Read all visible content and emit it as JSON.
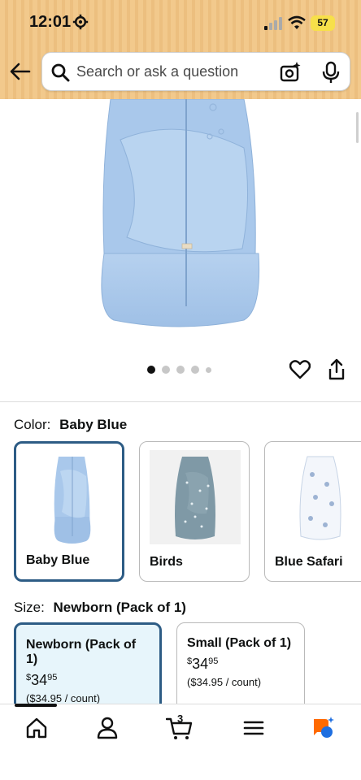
{
  "status_bar": {
    "time": "12:01",
    "battery": "57",
    "icons": [
      "gear-icon",
      "signal-icon",
      "wifi-icon",
      "battery-icon"
    ]
  },
  "search": {
    "placeholder": "Search or ask a question",
    "icons": [
      "back-arrow-icon",
      "search-icon",
      "camera-icon",
      "microphone-icon"
    ]
  },
  "image_carousel": {
    "total_slides": 5,
    "active_index": 0,
    "actions": [
      "heart-icon",
      "share-icon"
    ]
  },
  "color": {
    "label": "Color:",
    "selected": "Baby Blue",
    "options": [
      {
        "name": "Baby Blue"
      },
      {
        "name": "Birds"
      },
      {
        "name": "Blue Safari"
      }
    ]
  },
  "size": {
    "label": "Size:",
    "selected": "Newborn (Pack of 1)",
    "options": [
      {
        "title": "Newborn (Pack of 1)",
        "price_whole": "34",
        "price_fraction": "95",
        "price_currency": "$",
        "unit_price": "($34.95 / count)"
      },
      {
        "title": "Small (Pack of 1)",
        "price_whole": "34",
        "price_fraction": "95",
        "price_currency": "$",
        "unit_price": "($34.95 / count)"
      }
    ]
  },
  "bottom_nav": {
    "cart_count": "3",
    "items": [
      "home-icon",
      "account-icon",
      "cart-icon",
      "menu-icon",
      "rufus-icon"
    ]
  },
  "colors": {
    "header_tan": "#f2c98c",
    "selected_border": "#2d5c85",
    "selected_fill": "#e7f5fb",
    "product_blue": "#a9c8eb"
  }
}
